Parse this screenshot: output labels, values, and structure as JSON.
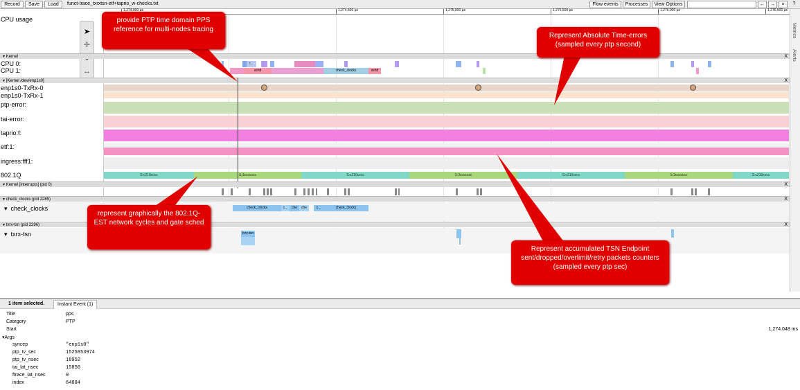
{
  "toolbar": {
    "record": "Record",
    "save": "Save",
    "load": "Load",
    "title": "funct-trace_txrxtsn-etf+taprio_w-checks.txt",
    "flow_events": "Flow events",
    "processes": "Processes",
    "view_options": "View Options",
    "nav_back": "←",
    "nav_fwd": "→",
    "nav_close": "×",
    "help": "?"
  },
  "ruler": {
    "ticks": [
      "1,274,000 µs",
      "1,274,500 µs",
      "1,275,000 µs",
      "1,275,500 µs",
      "1,276,000 µs",
      "1,276,500 µs"
    ]
  },
  "side": {
    "metrics": "Metrics",
    "alerts": "Alerts"
  },
  "tracks": {
    "cpu_usage": "CPU usage",
    "cpu0": "CPU 0:",
    "cpu1": "CPU 1:",
    "enp_txrx0": "enp1s0-TxRx-0",
    "enp_txrx1": "enp1s0-TxRx-1",
    "ptp_error": "ptp-error:",
    "tai_error": "tai-error:",
    "taprio": "taprio:f:",
    "etf": "etf:1:",
    "ingress": "ingress:fff1:",
    "dot1q": "802.1Q",
    "check_clocks": "check_clocks",
    "txrx_tsn": "txrx-tsn"
  },
  "headers": {
    "kernel": "Kernel",
    "kernel_dev": "[Kernel /dev/enp1s0]",
    "interrupts": "Kernel [interrupts] (pid 0)",
    "check_clocks": "check_clocks (pid 2285)",
    "txrx": "txrx-tsn (pid 2296)",
    "close": "X",
    "toggle": "▾"
  },
  "cpu_slices": {
    "sshd": "sshd",
    "check_clocks": "check_clocks",
    "t": "t..."
  },
  "dot1q_segments": [
    "S:c210cccc",
    "S:3ccccccc",
    "S:c210cccc",
    "S:3ccccccc",
    "S:c210cccc",
    "S:3ccccccc",
    "S:c210cccc"
  ],
  "check_clocks_slices": [
    "check_clocks",
    "c...",
    "che",
    "che",
    "c...",
    "check_clocks"
  ],
  "txrx_slice": "txrx-tsn",
  "callouts": {
    "pps": "provide PTP time domain PPS reference for multi-nodes tracing",
    "abs": "Represent Absolute Time-errors (sampled every ptp second)",
    "est": "represent graphically the 802.1Q-EST network cycles and gate sched",
    "acc": "Represent accumulated  TSN Endpoint sent/dropped/overlimit/retry packets counters (sampled every ptp sec)"
  },
  "analysis": {
    "selected": "1 item selected.",
    "tab": "Instant Event (1)",
    "rows": [
      {
        "k": "Title",
        "v": "pps"
      },
      {
        "k": "Category",
        "v": "PTP"
      },
      {
        "k": "Start",
        "v": "1,274.048 ms"
      }
    ],
    "args_label": "▾Args",
    "args": [
      {
        "k": "syncep",
        "v": "\"enp1s0\""
      },
      {
        "k": "ptp_tv_sec",
        "v": "1525853974"
      },
      {
        "k": "ptp_tv_nsec",
        "v": "18952"
      },
      {
        "k": "tai_lat_nsec",
        "v": "15850"
      },
      {
        "k": "ftrace_lat_nsec",
        "v": "0"
      },
      {
        "k": "index",
        "v": "64884"
      }
    ]
  },
  "colors": {
    "ptp": "#c9dfb6",
    "tai": "#f9d0d3",
    "taprio": "#f37fe2",
    "etf": "#f492c4",
    "callout": "#e10000",
    "dot1q_a": "#7fd9c6",
    "dot1q_b": "#a9d77c"
  }
}
